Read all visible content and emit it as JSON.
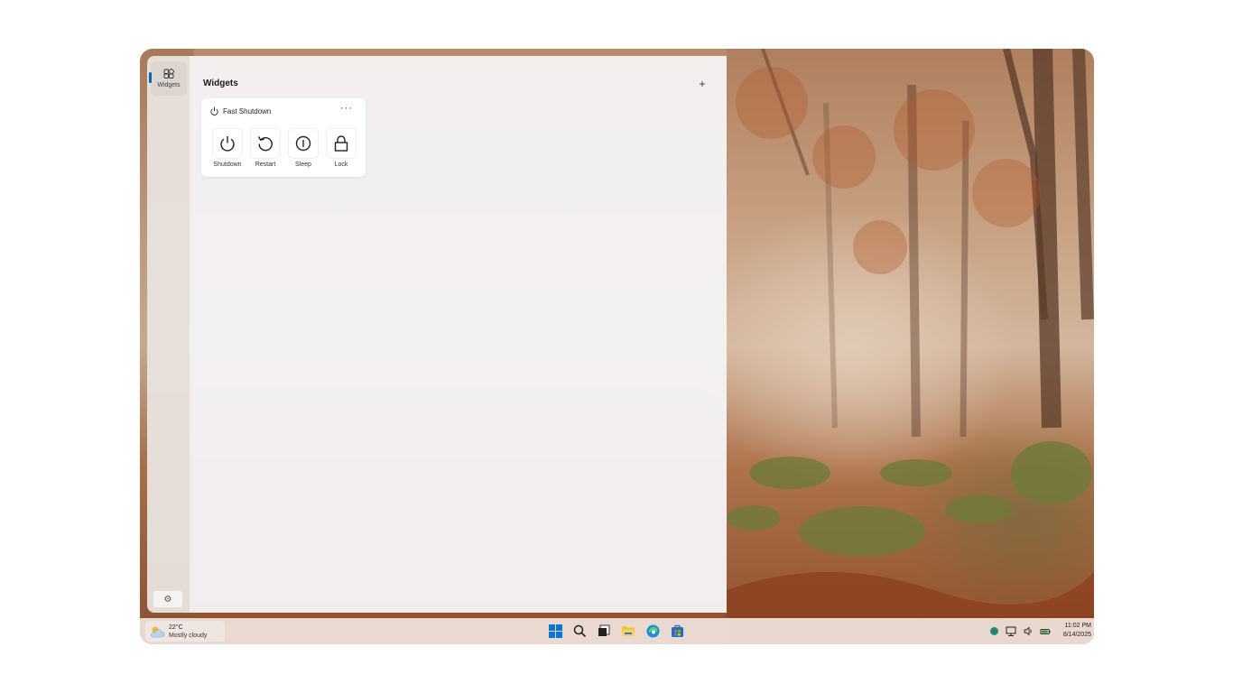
{
  "panel": {
    "rail_label": "Widgets",
    "title": "Widgets",
    "add_symbol": "+"
  },
  "widget": {
    "title": "Fast Shutdown",
    "menu_symbol": "···",
    "actions": [
      {
        "label": "Shutdown",
        "icon": "power-icon"
      },
      {
        "label": "Restart",
        "icon": "restart-icon"
      },
      {
        "label": "Sleep",
        "icon": "sleep-icon"
      },
      {
        "label": "Lock",
        "icon": "lock-icon"
      }
    ]
  },
  "taskbar": {
    "weather": {
      "temp": "22°C",
      "condition": "Mostly cloudy",
      "icon": "cloud-sun-icon"
    },
    "apps": [
      "start-icon",
      "search-icon",
      "task-view-icon",
      "file-explorer-icon",
      "edge-icon",
      "store-icon"
    ],
    "tray_icons": [
      "defender-icon",
      "network-icon",
      "volume-icon",
      "battery-icon"
    ],
    "time": "11:02 PM",
    "date": "8/14/2025"
  },
  "colors": {
    "accent": "#0067c0",
    "panel_bg": "#f3f1f1"
  }
}
